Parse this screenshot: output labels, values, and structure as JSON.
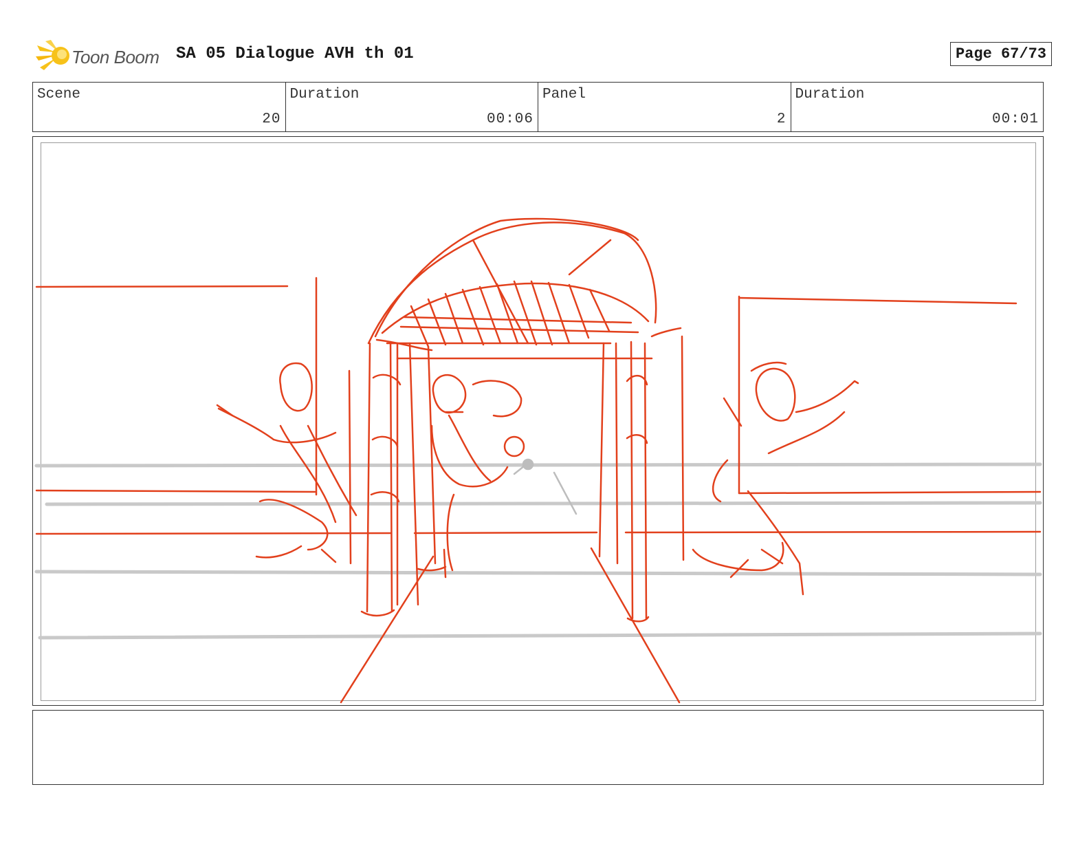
{
  "header": {
    "logo_text": "Toon Boom",
    "title": "SA 05 Dialogue AVH th 01",
    "page_label": "Page 67/73"
  },
  "info": {
    "scene_label": "Scene",
    "scene_value": "20",
    "scene_duration_label": "Duration",
    "scene_duration_value": "00:06",
    "panel_label": "Panel",
    "panel_value": "2",
    "panel_duration_label": "Duration",
    "panel_duration_value": "00:01"
  },
  "colors": {
    "sketch": "#e2401c",
    "guide": "#c9c9c9",
    "logo_yellow": "#f7c21a"
  },
  "notes": {
    "text": ""
  }
}
